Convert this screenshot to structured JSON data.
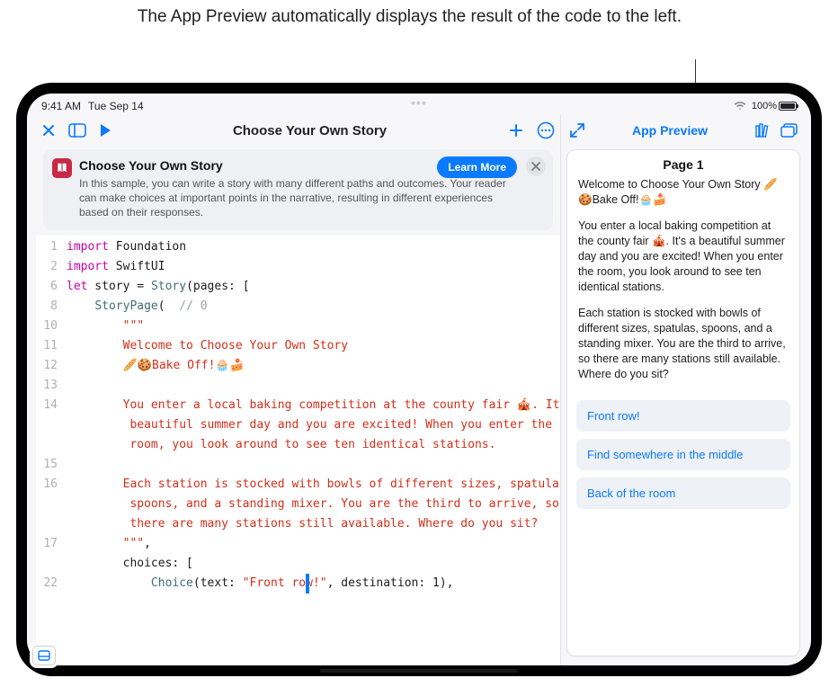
{
  "caption": "The App Preview automatically displays the result of the code to the left.",
  "statusbar": {
    "time": "9:41 AM",
    "date": "Tue Sep 14",
    "battery_pct": "100%"
  },
  "editor": {
    "title": "Choose Your Own Story",
    "banner": {
      "icon_name": "book-icon",
      "title": "Choose Your Own Story",
      "desc": "In this sample, you can write a story with many different paths and outcomes. Your reader can make choices at important points in the narrative, resulting in different experiences based on their responses.",
      "learn_label": "Learn More"
    },
    "lines": [
      {
        "n": "1",
        "segs": [
          {
            "t": "import",
            "c": "kw"
          },
          {
            "t": " Foundation",
            "c": "plain"
          }
        ]
      },
      {
        "n": "2",
        "segs": [
          {
            "t": "import",
            "c": "kw"
          },
          {
            "t": " SwiftUI",
            "c": "plain"
          }
        ]
      },
      {
        "n": "",
        "segs": [
          {
            "t": "",
            "c": "plain"
          }
        ]
      },
      {
        "n": "6",
        "segs": [
          {
            "t": "let",
            "c": "kw"
          },
          {
            "t": " story = ",
            "c": "plain"
          },
          {
            "t": "Story",
            "c": "tp"
          },
          {
            "t": "(pages: [",
            "c": "plain"
          }
        ]
      },
      {
        "n": "8",
        "segs": [
          {
            "t": "    ",
            "c": "plain"
          },
          {
            "t": "StoryPage",
            "c": "tp"
          },
          {
            "t": "( ",
            "c": "plain"
          },
          {
            "t": " // 0",
            "c": "cmt"
          }
        ]
      },
      {
        "n": "10",
        "segs": [
          {
            "t": "        ",
            "c": "plain"
          },
          {
            "t": "\"\"\"",
            "c": "str"
          }
        ]
      },
      {
        "n": "11",
        "segs": [
          {
            "t": "        Welcome to Choose Your Own Story",
            "c": "str"
          }
        ]
      },
      {
        "n": "12",
        "segs": [
          {
            "t": "        🥖🍪Bake Off!🧁🍰",
            "c": "str"
          }
        ]
      },
      {
        "n": "13",
        "segs": [
          {
            "t": "",
            "c": "plain"
          }
        ]
      },
      {
        "n": "14",
        "segs": [
          {
            "t": "        You enter a local baking competition at the county fair 🎪. It's a",
            "c": "str"
          }
        ]
      },
      {
        "n": "",
        "segs": [
          {
            "t": "         beautiful summer day and you are excited! When you enter the",
            "c": "str"
          }
        ]
      },
      {
        "n": "",
        "segs": [
          {
            "t": "         room, you look around to see ten identical stations.",
            "c": "str"
          }
        ]
      },
      {
        "n": "15",
        "segs": [
          {
            "t": "",
            "c": "plain"
          }
        ]
      },
      {
        "n": "16",
        "segs": [
          {
            "t": "        Each station is stocked with bowls of different sizes, spatulas,",
            "c": "str"
          }
        ]
      },
      {
        "n": "",
        "segs": [
          {
            "t": "         spoons, and a standing mixer. You are the third to arrive, so",
            "c": "str"
          }
        ]
      },
      {
        "n": "",
        "segs": [
          {
            "t": "         there are many stations still available. Where do you sit?",
            "c": "str"
          }
        ]
      },
      {
        "n": "17",
        "segs": [
          {
            "t": "        ",
            "c": "plain"
          },
          {
            "t": "\"\"\"",
            "c": "str"
          },
          {
            "t": ",",
            "c": "plain"
          }
        ]
      },
      {
        "n": "",
        "segs": [
          {
            "t": "        choices: [",
            "c": "plain"
          }
        ]
      },
      {
        "n": "22",
        "cursor_after": 1,
        "segs": [
          {
            "t": "            ",
            "c": "plain"
          },
          {
            "t": "Choice",
            "c": "tp"
          },
          {
            "t": "(text: ",
            "c": "plain"
          },
          {
            "t": "\"Front row!\"",
            "c": "str"
          },
          {
            "t": ", destination: ",
            "c": "plain"
          },
          {
            "t": "1",
            "c": "plain"
          },
          {
            "t": "),",
            "c": "plain"
          }
        ]
      }
    ]
  },
  "preview": {
    "header": "App Preview",
    "page_title": "Page 1",
    "paras": [
      "Welcome to Choose Your Own Story 🥖🍪Bake Off!🧁🍰",
      "You enter a local baking competition at the county fair 🎪. It's a beautiful summer day and you are excited! When you enter the room, you look around to see ten identical stations.",
      "Each station is stocked with bowls of different sizes, spatulas, spoons, and a standing mixer. You are the third to arrive, so there are many stations still available. Where do you sit?"
    ],
    "options": [
      "Front row!",
      "Find somewhere in the middle",
      "Back of the room"
    ]
  }
}
